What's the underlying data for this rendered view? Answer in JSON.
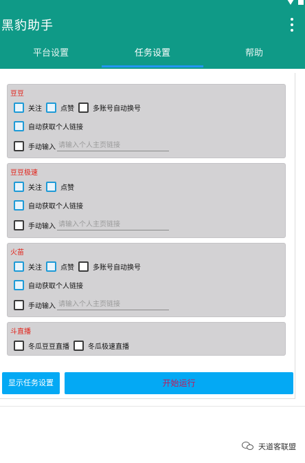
{
  "app": {
    "title": "黑豹助手"
  },
  "tabs": [
    {
      "label": "平台设置",
      "active": false
    },
    {
      "label": "任务设置",
      "active": true
    },
    {
      "label": "帮助",
      "active": false
    }
  ],
  "sections": [
    {
      "title": "豆豆",
      "row1": [
        "关注",
        "点赞",
        "多账号自动换号"
      ],
      "auto_link": "自动获取个人链接",
      "manual_label": "手动输入",
      "manual_placeholder": "请输入个人主页链接"
    },
    {
      "title": "豆豆极速",
      "row1": [
        "关注",
        "点赞"
      ],
      "auto_link": "自动获取个人链接",
      "manual_label": "手动输入",
      "manual_placeholder": "请输入个人主页链接"
    },
    {
      "title": "火苗",
      "row1": [
        "关注",
        "点赞",
        "多账号自动换号"
      ],
      "auto_link": "自动获取个人链接",
      "manual_label": "手动输入",
      "manual_placeholder": "请输入个人主页链接"
    },
    {
      "title": "斗直播",
      "row1": [
        "冬瓜豆豆直播",
        "冬瓜极速直播"
      ]
    }
  ],
  "buttons": {
    "show_task_settings": "显示任务设置",
    "start": "开始运行"
  },
  "watermark": {
    "text": "天道客联盟"
  },
  "colors": {
    "primary": "#0f9a87",
    "tab_indicator": "#2196f3",
    "button": "#04a9f4",
    "section_title": "#e2231a",
    "start_text": "#c2185b"
  }
}
